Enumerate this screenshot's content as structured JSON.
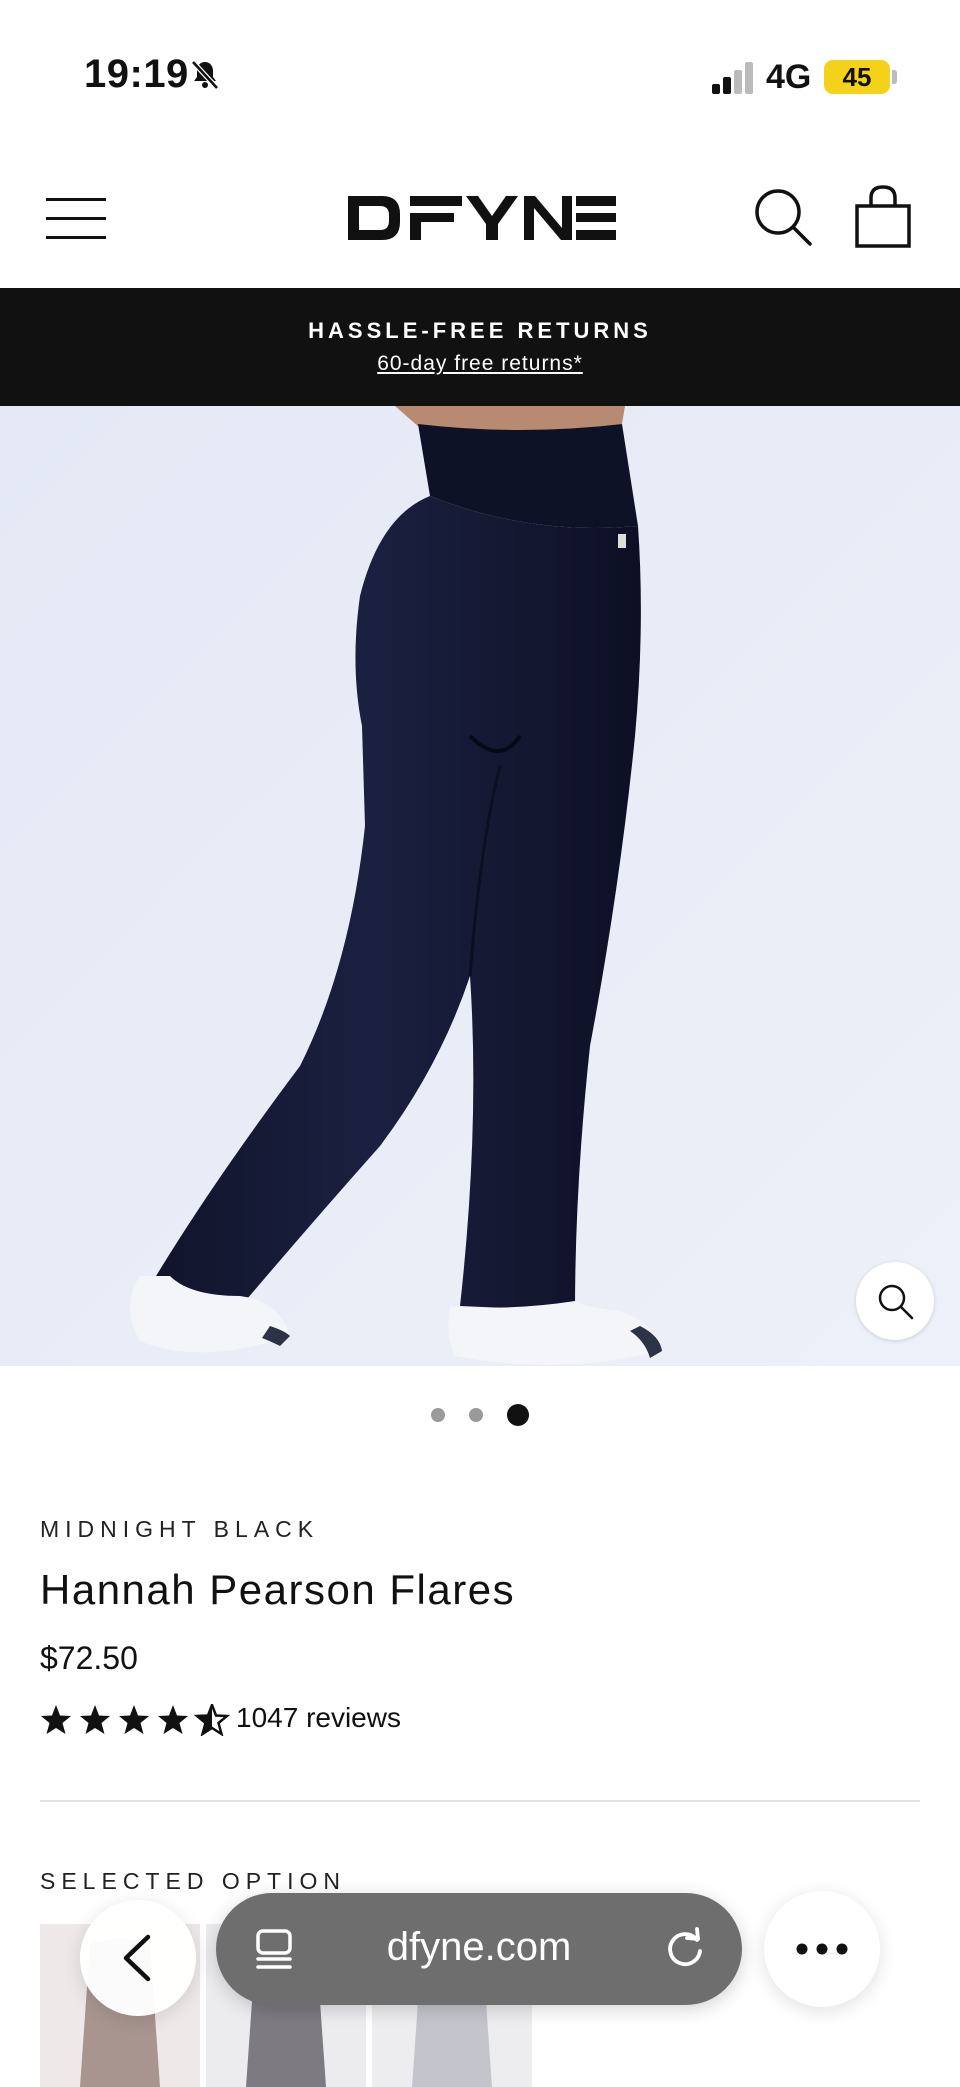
{
  "status_bar": {
    "time": "19:19",
    "network": "4G",
    "battery": "45"
  },
  "header": {
    "logo_text": "DFYNE",
    "icons": [
      "menu-icon",
      "search-icon",
      "bag-icon"
    ]
  },
  "announcement": {
    "title": "HASSLE-FREE RETURNS",
    "link": "60-day free returns*"
  },
  "gallery": {
    "slide_count": 3,
    "active_slide": 3
  },
  "product": {
    "color": "MIDNIGHT BLACK",
    "title": "Hannah Pearson Flares",
    "price": "$72.50",
    "rating": 4.5,
    "reviews": "1047 reviews",
    "selected_option_label": "SELECTED OPTION"
  },
  "browser": {
    "url": "dfyne.com"
  },
  "colors": {
    "banner_bg": "#111111",
    "hero_bg": "#e9edf7",
    "battery": "#f5d21a",
    "url_pill": "#6e6e6e"
  }
}
